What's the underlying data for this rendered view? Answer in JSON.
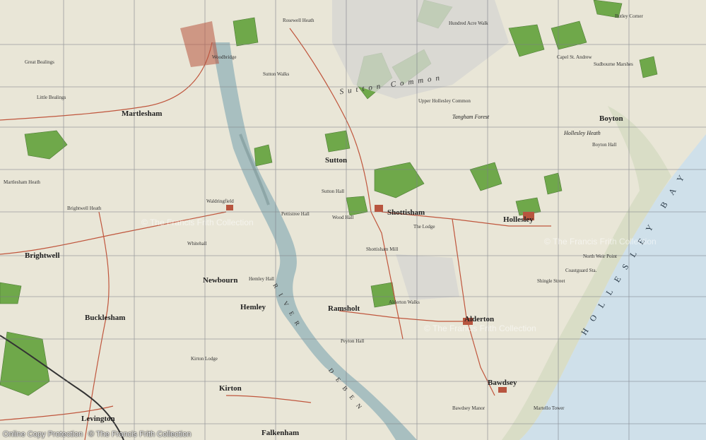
{
  "map": {
    "towns": [
      {
        "name": "Woodbridge",
        "cls": "small"
      },
      {
        "name": "Martlesham",
        "cls": "town"
      },
      {
        "name": "Sutton",
        "cls": "town"
      },
      {
        "name": "Shottisham",
        "cls": "town"
      },
      {
        "name": "Hollesley",
        "cls": "town"
      },
      {
        "name": "Brightwell",
        "cls": "town"
      },
      {
        "name": "Newbourn",
        "cls": "town"
      },
      {
        "name": "Ramsholt",
        "cls": "town"
      },
      {
        "name": "Alderton",
        "cls": "town"
      },
      {
        "name": "Bucklesham",
        "cls": "town"
      },
      {
        "name": "Kirton",
        "cls": "town"
      },
      {
        "name": "Bawdsey",
        "cls": "town"
      },
      {
        "name": "Levington",
        "cls": "town"
      },
      {
        "name": "Falkenham",
        "cls": "town"
      },
      {
        "name": "Boyton",
        "cls": "town"
      },
      {
        "name": "Capel St. Andrew",
        "cls": "small"
      },
      {
        "name": "Hemley",
        "cls": "town"
      },
      {
        "name": "Waldringfield",
        "cls": "small"
      },
      {
        "name": "Great Bealings",
        "cls": "small"
      },
      {
        "name": "Little Bealings",
        "cls": "small"
      }
    ],
    "labels": [
      {
        "text": "Sutton Common",
        "cls": "area"
      },
      {
        "text": "Hollesley Heath",
        "cls": "italic"
      },
      {
        "text": "Tangham Forest",
        "cls": "italic"
      },
      {
        "text": "Rosewell Heath",
        "cls": "small"
      },
      {
        "text": "Sutton Walks",
        "cls": "small"
      },
      {
        "text": "Upper Hollesley Common",
        "cls": "small"
      },
      {
        "text": "Hundred Acre Walk",
        "cls": "small"
      },
      {
        "text": "Martlesham Heath",
        "cls": "small"
      },
      {
        "text": "Brightwell Heath",
        "cls": "small"
      },
      {
        "text": "Kirton Lodge",
        "cls": "small"
      },
      {
        "text": "Sutton Hall",
        "cls": "small"
      },
      {
        "text": "Wood Hall",
        "cls": "small"
      },
      {
        "text": "Pettistree Hall",
        "cls": "small"
      },
      {
        "text": "The Lodge",
        "cls": "small"
      },
      {
        "text": "Shottisham Mill",
        "cls": "small"
      },
      {
        "text": "Alderton Walks",
        "cls": "small"
      },
      {
        "text": "Peyton Hall",
        "cls": "small"
      },
      {
        "text": "Coastguard Sta.",
        "cls": "small"
      },
      {
        "text": "North Weir Point",
        "cls": "small"
      },
      {
        "text": "Shingle Street",
        "cls": "small"
      },
      {
        "text": "Martello Tower",
        "cls": "small"
      },
      {
        "text": "Bawdsey Manor",
        "cls": "small"
      },
      {
        "text": "Whitehall",
        "cls": "small"
      },
      {
        "text": "Hemley Hall",
        "cls": "small"
      },
      {
        "text": "Boyton Hall",
        "cls": "small"
      },
      {
        "text": "Butley Corner",
        "cls": "small"
      },
      {
        "text": "Sudbourne Marshes",
        "cls": "small"
      }
    ],
    "rivers": [
      {
        "text": "DEBEN"
      },
      {
        "text": "RIVER"
      }
    ],
    "sea": {
      "text": "HOLLESLEY BAY"
    }
  },
  "watermark": "© The Francis Frith Collection",
  "footer": {
    "left": "Online Copy Protection",
    "right": "© The Francis Frith Collection"
  },
  "colors": {
    "land": "#e9e6d7",
    "sea": "#cfe0ea",
    "woodland": "#6fa84a",
    "river": "#a8bfc0",
    "roads": "#c0563d",
    "grid": "#7a7c86"
  }
}
